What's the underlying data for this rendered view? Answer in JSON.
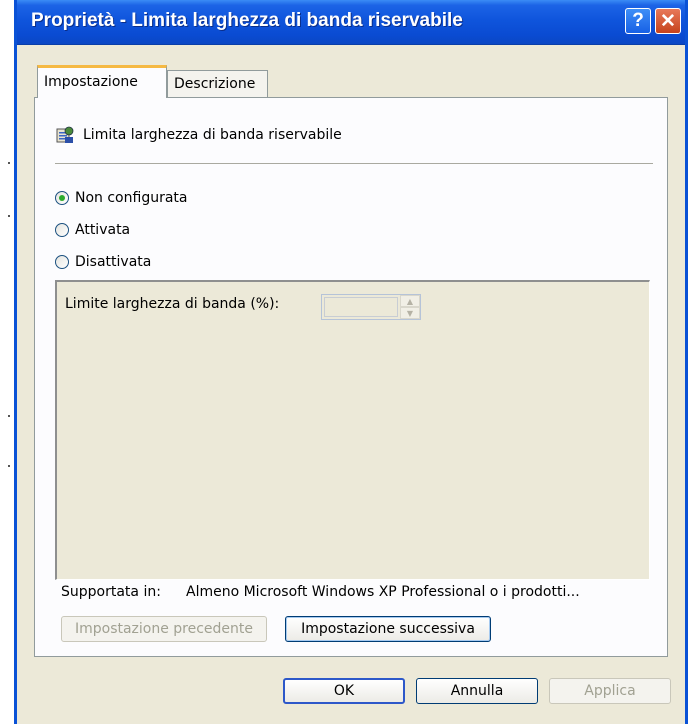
{
  "window": {
    "title": "Proprietà - Limita larghezza di banda riservabile",
    "help_label": "?",
    "close_label": "✕"
  },
  "tabs": [
    {
      "label": "Impostazione",
      "active": true
    },
    {
      "label": "Descrizione",
      "active": false
    }
  ],
  "policy": {
    "name": "Limita larghezza di banda riservabile",
    "icon": "policy-setting-icon"
  },
  "options": {
    "radios": [
      {
        "label": "Non configurata",
        "checked": true
      },
      {
        "label": "Attivata",
        "checked": false
      },
      {
        "label": "Disattivata",
        "checked": false
      }
    ],
    "limit_label": "Limite larghezza di banda (%):",
    "limit_value": ""
  },
  "supported": {
    "label": "Supportata in:",
    "value": "Almeno Microsoft Windows XP Professional o i prodotti..."
  },
  "nav": {
    "prev_label": "Impostazione precedente",
    "next_label": "Impostazione successiva"
  },
  "buttons": {
    "ok": "OK",
    "cancel": "Annulla",
    "apply": "Applica"
  },
  "colors": {
    "titlebar": "#0a4bd2",
    "dialog_bg": "#ece9d8",
    "active_tab_accent": "#f5b943"
  }
}
